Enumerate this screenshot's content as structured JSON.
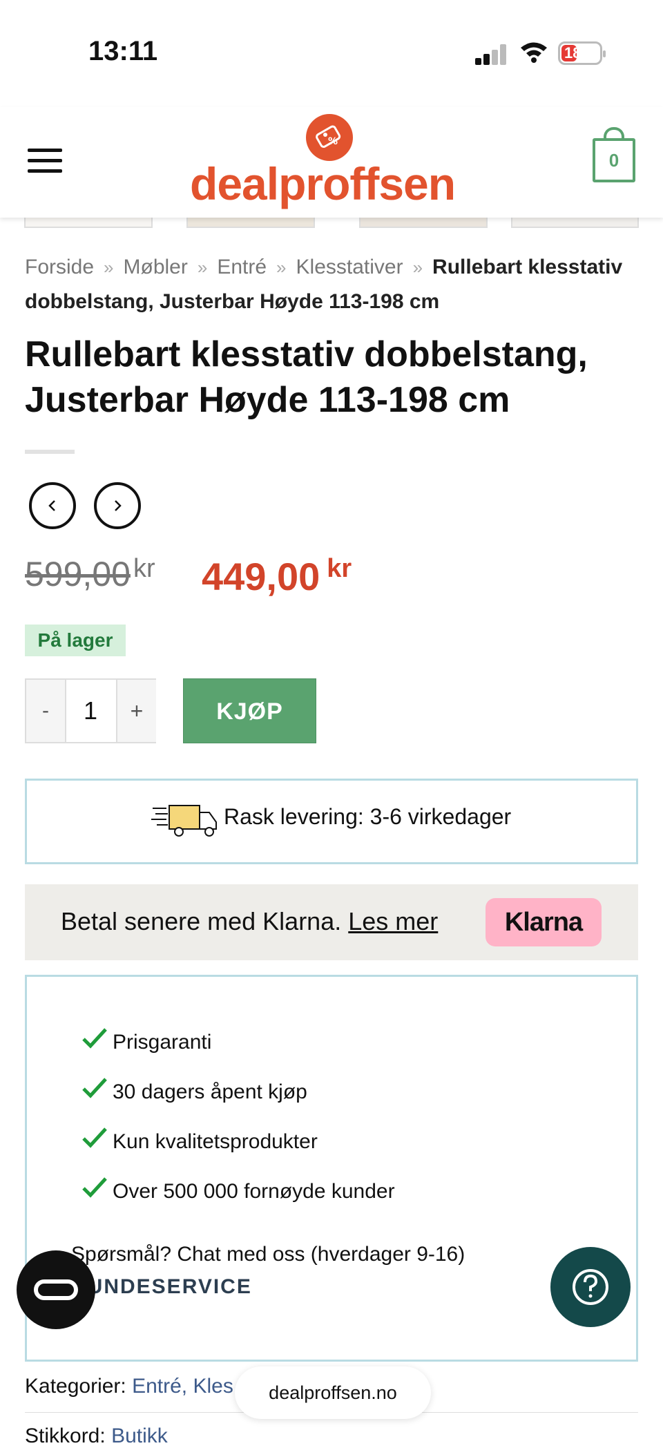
{
  "status_bar": {
    "time": "13:11",
    "battery": "18"
  },
  "header": {
    "logo_text": "dealproffsen",
    "cart_count": "0"
  },
  "breadcrumb": {
    "items": [
      "Forside",
      "Møbler",
      "Entré",
      "Klesstativer"
    ],
    "separator": "»",
    "current": "Rullebart klesstativ dobbelstang, Justerbar Høyde 113-198 cm"
  },
  "product": {
    "title": "Rullebart klesstativ dobbelstang, Justerbar Høyde 113-198 cm",
    "old_price": "599,00",
    "new_price": "449,00",
    "currency": "kr",
    "stock": "På lager",
    "quantity": "1",
    "minus": "-",
    "plus": "+",
    "buy_label": "KJØP"
  },
  "delivery": {
    "text": "Rask levering: 3-6 virkedager"
  },
  "klarna": {
    "text": "Betal senere med Klarna.",
    "link": "Les mer",
    "badge": "Klarna"
  },
  "usps": [
    "Prisgaranti",
    "30 dagers åpent kjøp",
    "Kun kvalitetsprodukter",
    "Over 500 000 fornøyde kunder"
  ],
  "support": {
    "question": "Spørsmål? Chat med oss (hverdager 9-16)",
    "link": "KUNDESERVICE"
  },
  "meta": {
    "categories_label": "Kategorier:",
    "categories": "Entré, Kles",
    "tags_label": "Stikkord:",
    "tags": "Butikk"
  },
  "browser": {
    "url": "dealproffsen.no"
  },
  "colors": {
    "brand": "#e2532e",
    "accent_green": "#5aa36f",
    "sale_red": "#d2442a",
    "help": "#14494a"
  }
}
